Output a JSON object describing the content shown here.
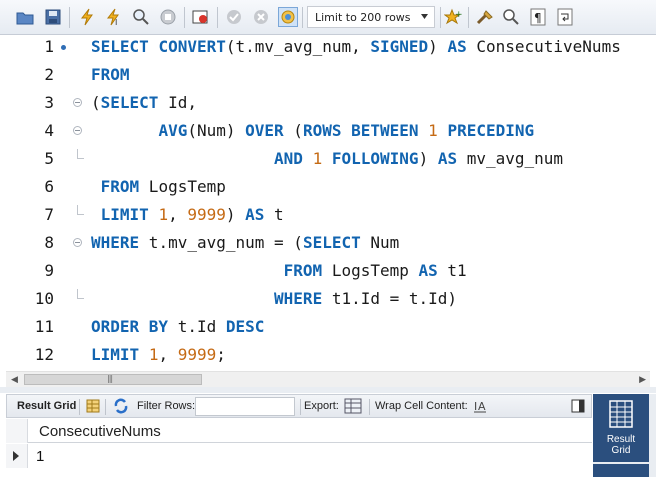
{
  "toolbar": {
    "limit_label": "Limit to 200 rows",
    "icons": [
      "open-folder-icon",
      "save-icon",
      "execute-icon",
      "execute-current-icon",
      "explain-icon",
      "stop-icon",
      "toggle-error-icon",
      "commit-icon",
      "rollback-icon",
      "autocommit-icon",
      "beautify-icon",
      "find-icon",
      "invisible-chars-icon",
      "wrap-icon"
    ]
  },
  "editor": {
    "lines": [
      {
        "n": "1"
      },
      {
        "n": "2"
      },
      {
        "n": "3"
      },
      {
        "n": "4"
      },
      {
        "n": "5"
      },
      {
        "n": "6"
      },
      {
        "n": "7"
      },
      {
        "n": "8"
      },
      {
        "n": "9"
      },
      {
        "n": "10"
      },
      {
        "n": "11"
      },
      {
        "n": "12"
      }
    ],
    "tokens": {
      "l1": [
        "SELECT",
        "CONVERT",
        "(t.mv_avg_num, ",
        "SIGNED",
        ") ",
        "AS",
        " ConsecutiveNums"
      ],
      "l2": [
        "FROM"
      ],
      "l3": [
        "(",
        "SELECT",
        " Id,"
      ],
      "l4": [
        "AVG",
        "(Num) ",
        "OVER",
        " (",
        "ROWS BETWEEN",
        " ",
        "1",
        " ",
        "PRECEDING"
      ],
      "l5": [
        "AND",
        " ",
        "1",
        " ",
        "FOLLOWING",
        ") ",
        "AS",
        " mv_avg_num"
      ],
      "l6": [
        "FROM",
        " LogsTemp"
      ],
      "l7": [
        "LIMIT",
        " ",
        "1",
        ", ",
        "9999",
        ") ",
        "AS",
        " t"
      ],
      "l8": [
        "WHERE",
        " t.mv_avg_num = (",
        "SELECT",
        " Num"
      ],
      "l9": [
        "FROM",
        " LogsTemp ",
        "AS",
        " t1"
      ],
      "l10": [
        "WHERE",
        " t1.Id = t.Id)"
      ],
      "l11": [
        "ORDER BY",
        " t.Id ",
        "DESC"
      ],
      "l12": [
        "LIMIT",
        " ",
        "1",
        ", ",
        "9999",
        ";"
      ]
    }
  },
  "result_toolbar": {
    "result_grid": "Result Grid",
    "filter_rows": "Filter Rows:",
    "export": "Export:",
    "wrap_cell": "Wrap Cell Content:",
    "filter_value": ""
  },
  "grid": {
    "columns": [
      "ConsecutiveNums"
    ],
    "rows": [
      [
        "1"
      ]
    ]
  },
  "side": {
    "result_grid_label_1": "Result",
    "result_grid_label_2": "Grid"
  }
}
